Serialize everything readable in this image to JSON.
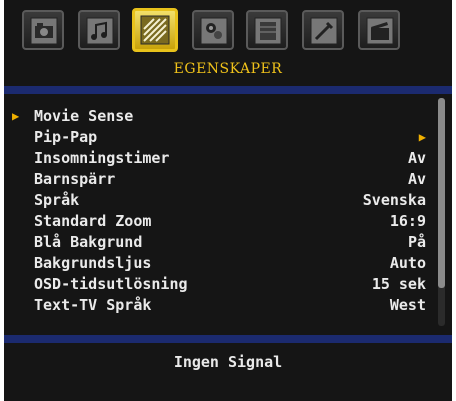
{
  "colors": {
    "background": "#151515",
    "accent": "#f0c21a",
    "separator": "#1b2a6f",
    "text": "#eaeaea"
  },
  "icon_bar": {
    "tabs": [
      {
        "icon": "picture-icon",
        "selected": false
      },
      {
        "icon": "sound-icon",
        "selected": false
      },
      {
        "icon": "features-icon",
        "selected": true
      },
      {
        "icon": "install-icon",
        "selected": false
      },
      {
        "icon": "source-icon",
        "selected": false
      },
      {
        "icon": "settings-icon",
        "selected": false
      },
      {
        "icon": "media-icon",
        "selected": false
      }
    ]
  },
  "section_title": "EGENSKAPER",
  "menu": {
    "items": [
      {
        "label": "Movie Sense",
        "value": "",
        "selected": true
      },
      {
        "label": "Pip-Pap",
        "value": "▶",
        "submenu": true
      },
      {
        "label": "Insomningstimer",
        "value": "Av"
      },
      {
        "label": "Barnspärr",
        "value": "Av"
      },
      {
        "label": "Språk",
        "value": "Svenska"
      },
      {
        "label": "Standard Zoom",
        "value": "16:9"
      },
      {
        "label": "Blå Bakgrund",
        "value": "På"
      },
      {
        "label": "Bakgrundsljus",
        "value": "Auto"
      },
      {
        "label": "OSD-tidsutlösning",
        "value": "15 sek"
      },
      {
        "label": "Text-TV Språk",
        "value": "West"
      }
    ]
  },
  "status": "Ingen Signal"
}
